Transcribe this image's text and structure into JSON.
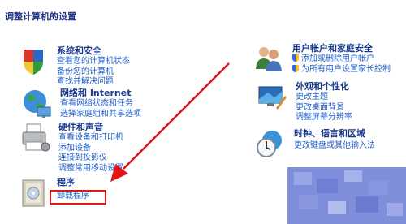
{
  "page": {
    "title": "调整计算机的设置"
  },
  "categories": [
    {
      "key": "security",
      "title": "系统和安全",
      "links": [
        "查看您的计算机状态",
        "备份您的计算机",
        "查找并解决问题"
      ]
    },
    {
      "key": "network",
      "title": "网络和 Internet",
      "links": [
        "查看网络状态和任务",
        "选择家庭组和共享选项"
      ]
    },
    {
      "key": "hardware",
      "title": "硬件和声音",
      "links": [
        "查看设备和打印机",
        "添加设备",
        "连接到投影仪",
        "调整常用移动设置"
      ]
    },
    {
      "key": "programs",
      "title": "程序",
      "links": [
        "卸载程序"
      ]
    },
    {
      "key": "users",
      "title": "用户帐户和家庭安全",
      "links": [
        "添加或删除用户帐户",
        "为所有用户设置家长控制"
      ]
    },
    {
      "key": "appearance",
      "title": "外观和个性化",
      "links": [
        "更改主题",
        "更改桌面背景",
        "调整屏幕分辨率"
      ]
    },
    {
      "key": "clock",
      "title": "时钟、语言和区域",
      "links": [
        "更改键盘或其他输入法"
      ]
    }
  ],
  "annotation": {
    "color": "#e01515"
  }
}
